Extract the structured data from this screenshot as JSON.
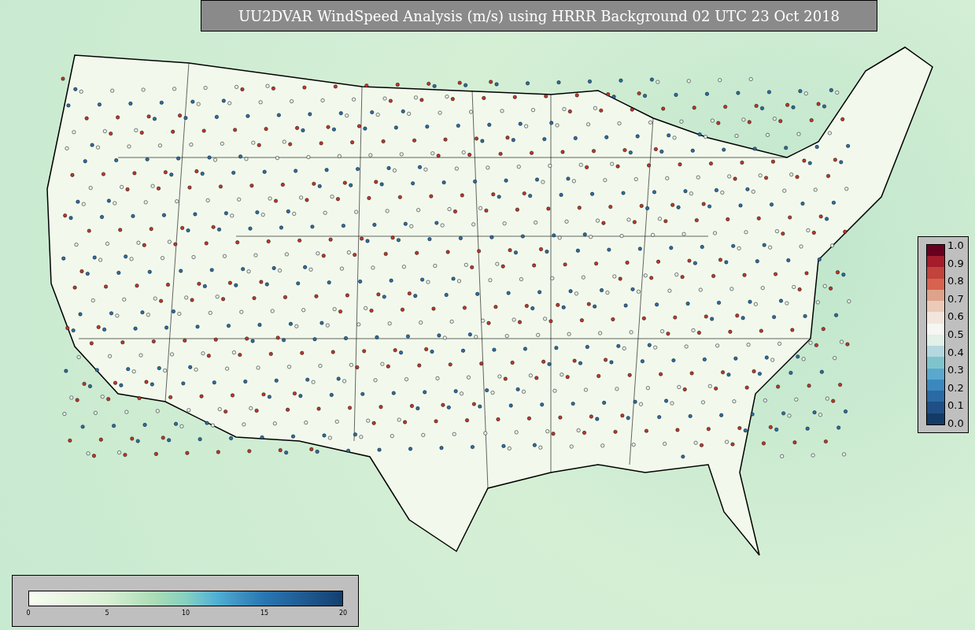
{
  "title": "UU2DVAR WindSpeed Analysis (m/s) using HRRR Background 02 UTC 23 Oct 2018",
  "wind_colorbar": {
    "ticks": [
      "0",
      "5",
      "10",
      "15",
      "20"
    ]
  },
  "ratio_colorbar": {
    "ticks": [
      "1.0",
      "0.9",
      "0.8",
      "0.7",
      "0.6",
      "0.5",
      "0.4",
      "0.3",
      "0.2",
      "0.1",
      "0.0"
    ]
  }
}
